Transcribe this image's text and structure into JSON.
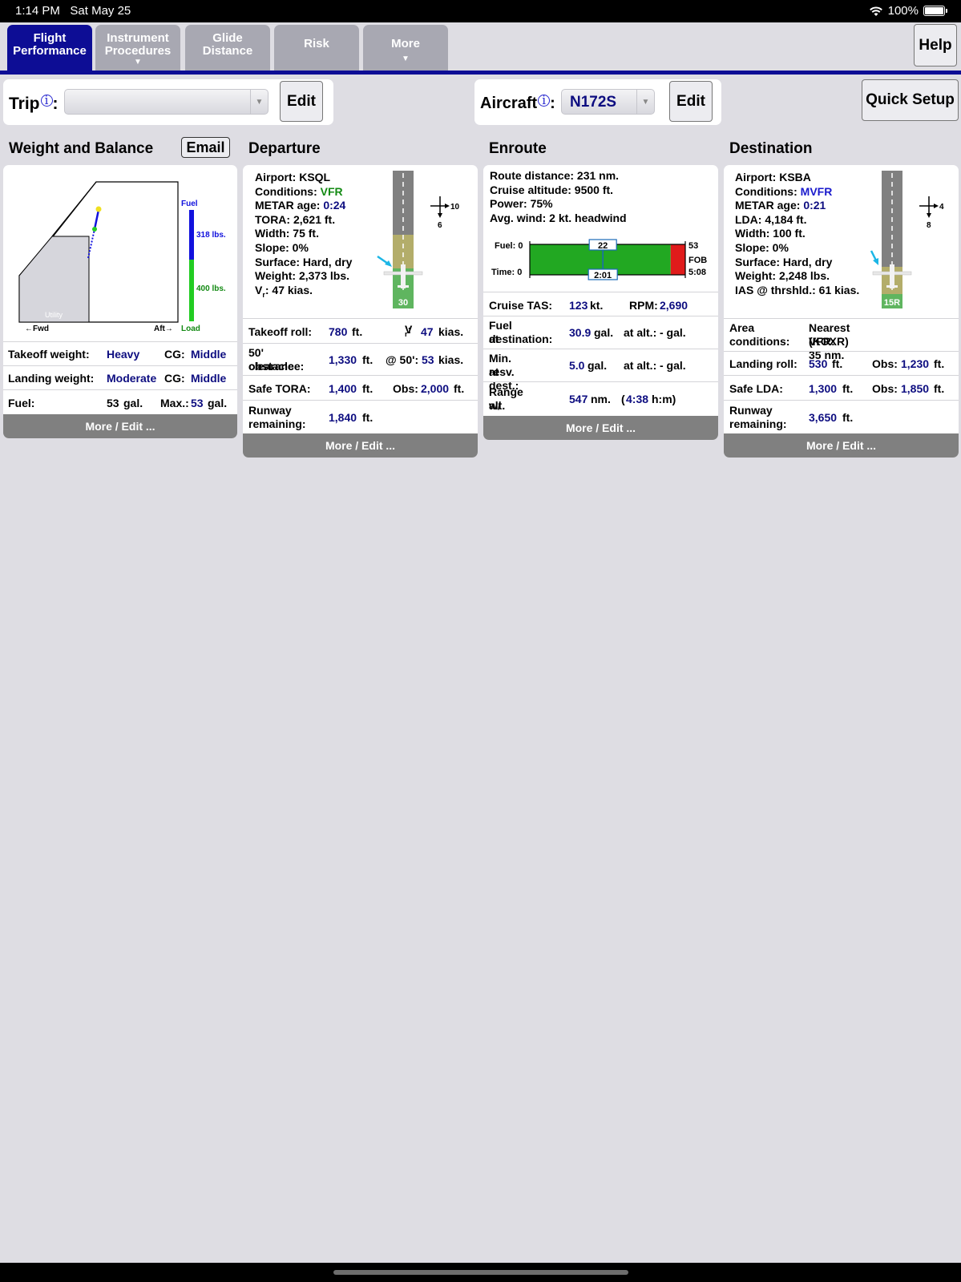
{
  "status_bar": {
    "time": "1:14 PM",
    "date": "Sat May 25",
    "battery": "100%"
  },
  "tabs": [
    {
      "line1": "Flight",
      "line2": "Performance",
      "caret": ""
    },
    {
      "line1": "Instrument",
      "line2": "Procedures",
      "caret": "▼"
    },
    {
      "line1": "Glide",
      "line2": "Distance",
      "caret": ""
    },
    {
      "line1": "Risk",
      "line2": "",
      "caret": ""
    },
    {
      "line1": "More",
      "line2": "",
      "caret": "▼"
    }
  ],
  "help_label": "Help",
  "trip": {
    "label": "Trip",
    "info": "i",
    "colon": ":",
    "value": "",
    "edit_label": "Edit"
  },
  "aircraft": {
    "label": "Aircraft",
    "info": "i",
    "colon": ":",
    "value": "N172S",
    "edit_label": "Edit"
  },
  "quick_setup_label": "Quick Setup",
  "weight_balance": {
    "title": "Weight and Balance",
    "email_label": "Email",
    "chart": {
      "fuel_label": "Fuel",
      "fuel_weight": "318 lbs.",
      "load_weight": "400 lbs.",
      "load_label": "Load",
      "fwd_label": "←Fwd",
      "aft_label": "Aft→",
      "utility_label": "Utility",
      "fuel_color": "#1111dd",
      "load_color": "#22cc22"
    },
    "rows": [
      {
        "label": "Takeoff weight:",
        "value": "Heavy",
        "cg_label": "CG:",
        "cg_value": "Middle"
      },
      {
        "label": "Landing weight:",
        "value": "Moderate",
        "cg_label": "CG:",
        "cg_value": "Middle"
      }
    ],
    "fuel": {
      "label": "Fuel:",
      "value": "53",
      "unit": "gal.",
      "max_label": "Max.:",
      "max_value": "53",
      "max_unit": "gal."
    },
    "more_label": "More / Edit ..."
  },
  "departure": {
    "title": "Departure",
    "airport": "Airport: KSQL",
    "conditions_label": "Conditions: ",
    "conditions_value": "VFR",
    "metar_label": "METAR age: ",
    "metar_value": "0:24",
    "tora": "TORA: 2,621 ft.",
    "width": "Width: 75 ft.",
    "slope": "Slope: 0%",
    "surface": "Surface: Hard, dry",
    "weight": "Weight: 2,373 lbs.",
    "vr_v": "V",
    "vr_sub": "r",
    "vr_rest": ": 47 kias.",
    "runway_number": "30",
    "wind_head": "10",
    "wind_cross": "6",
    "takeoff_roll": {
      "label": "Takeoff roll:",
      "value": "780",
      "unit": "ft.",
      "vr_v": "V",
      "vr_sub": "r",
      "vr_colon": ":",
      "vr_value": "47",
      "vr_unit": "kias."
    },
    "obstacle": {
      "label1": "50' obstacle",
      "label2": "clearance:",
      "value": "1,330",
      "unit": "ft.",
      "at_label": "@ 50':",
      "at_value": "53",
      "at_unit": "kias."
    },
    "safe_tora": {
      "label": "Safe TORA:",
      "value": "1,400",
      "unit": "ft.",
      "obs_label": "Obs:",
      "obs_value": "2,000",
      "obs_unit": "ft."
    },
    "runway_remaining": {
      "label1": "Runway",
      "label2": "remaining:",
      "value": "1,840",
      "unit": "ft."
    },
    "more_label": "More / Edit ..."
  },
  "enroute": {
    "title": "Enroute",
    "route_distance": "Route distance: 231 nm.",
    "cruise_altitude": "Cruise altitude: 9500 ft.",
    "power": "Power: 75%",
    "avg_wind": "Avg. wind: 2 kt. headwind",
    "bar": {
      "fuel_label": "Fuel: 0",
      "time_label": "Time: 0",
      "fuel_mark": "22",
      "time_mark": "2:01",
      "fuel_total": "53",
      "fob": "FOB",
      "time_total": "5:08",
      "used_fraction": 0.47,
      "reserve_fraction": 0.094
    },
    "cruise_tas": {
      "label": "Cruise TAS:",
      "value": "123",
      "unit": "kt.",
      "rpm_label": "RPM:",
      "rpm_value": "2,690"
    },
    "fuel_dest": {
      "label1": "Fuel at",
      "label2": "destination:",
      "value": "30.9",
      "unit": "gal.",
      "alt_label": "at alt.:",
      "alt_value": "- gal."
    },
    "min_resv": {
      "label1": "Min. resv.",
      "label2": "at dest.:",
      "value": "5.0",
      "unit": "gal.",
      "alt_label": "at alt.:",
      "alt_value": "- gal."
    },
    "range": {
      "label1": "Range w/",
      "label2": "alt. resv.:",
      "value": "547",
      "unit": "nm.",
      "open": "(",
      "time": "4:38",
      "time_unit": "h:m)"
    },
    "more_label": "More / Edit ..."
  },
  "destination": {
    "title": "Destination",
    "airport": "Airport: KSBA",
    "conditions_label": "Conditions: ",
    "conditions_value": "MVFR",
    "metar_label": "METAR age: ",
    "metar_value": "0:21",
    "lda": "LDA: 4,184 ft.",
    "width": "Width: 100 ft.",
    "slope": "Slope: 0%",
    "surface": "Surface: Hard, dry",
    "weight": "Weight: 2,248 lbs.",
    "ias": "IAS @ thrshld.: 61 kias.",
    "runway_number": "15R",
    "wind_head": "4",
    "wind_cross": "8",
    "area": {
      "label1": "Area",
      "label2": "conditions:",
      "value1": "Nearest VFR: 35 nm.",
      "value2": "(KOXR)"
    },
    "landing_roll": {
      "label": "Landing roll:",
      "value": "530",
      "unit": "ft.",
      "obs_label": "Obs:",
      "obs_value": "1,230",
      "obs_unit": "ft."
    },
    "safe_lda": {
      "label": "Safe LDA:",
      "value": "1,300",
      "unit": "ft.",
      "obs_label": "Obs:",
      "obs_value": "1,850",
      "obs_unit": "ft."
    },
    "runway_remaining": {
      "label1": "Runway",
      "label2": "remaining:",
      "value": "3,650",
      "unit": "ft."
    },
    "more_label": "More / Edit ..."
  }
}
